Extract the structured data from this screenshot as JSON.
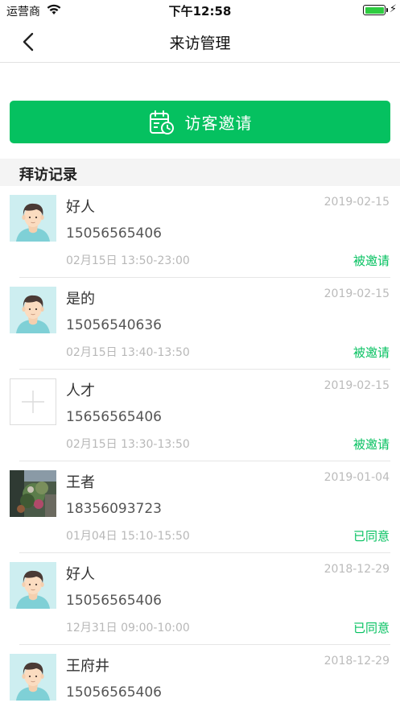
{
  "status_bar": {
    "carrier": "运营商",
    "time": "下午12:58",
    "battery_color": "#2ecc40"
  },
  "nav": {
    "title": "来访管理"
  },
  "invite_button": {
    "label": "访客邀请",
    "color": "#05c160"
  },
  "section": {
    "title": "拜访记录"
  },
  "records": [
    {
      "avatar": "person-avatar",
      "name": "好人",
      "phone": "15056565406",
      "timeslot": "02月15日 13:50-23:00",
      "date": "2019-02-15",
      "status": "被邀请"
    },
    {
      "avatar": "person-avatar",
      "name": "是的",
      "phone": "15056540636",
      "timeslot": "02月15日 13:40-13:50",
      "date": "2019-02-15",
      "status": "被邀请"
    },
    {
      "avatar": "placeholder-avatar",
      "name": "人才",
      "phone": "15656565406",
      "timeslot": "02月15日 13:30-13:50",
      "date": "2019-02-15",
      "status": "被邀请"
    },
    {
      "avatar": "photo-avatar",
      "name": "王者",
      "phone": "18356093723",
      "timeslot": "01月04日 15:10-15:50",
      "date": "2019-01-04",
      "status": "已同意"
    },
    {
      "avatar": "person-avatar",
      "name": "好人",
      "phone": "15056565406",
      "timeslot": "12月31日 09:00-10:00",
      "date": "2018-12-29",
      "status": "已同意"
    },
    {
      "avatar": "person-avatar",
      "name": "王府井",
      "phone": "15056565406",
      "timeslot": "",
      "date": "2018-12-29",
      "status": ""
    }
  ]
}
